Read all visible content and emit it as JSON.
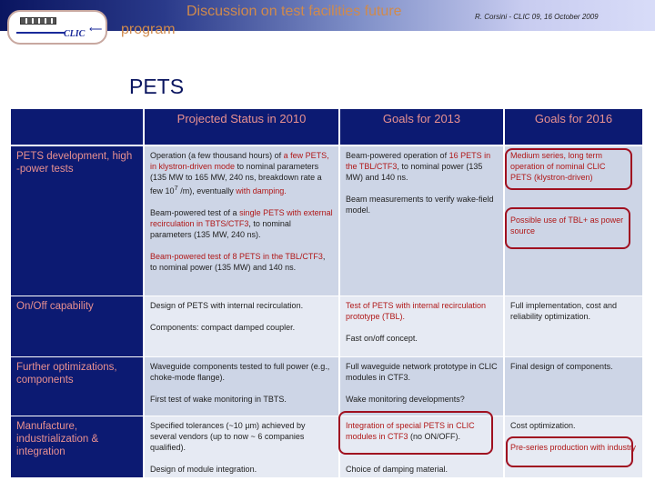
{
  "header": {
    "logo_text": "CLIC",
    "title_line1": "Discussion on test facilities future",
    "title_line2": "program",
    "author": "R. Corsini - CLIC 09, 16 October 2009"
  },
  "slide_title": "PETS",
  "table": {
    "columns": [
      "",
      "Projected Status in 2010",
      "Goals for 2013",
      "Goals for 2016"
    ],
    "rows": [
      {
        "label": "PETS development, high -power tests",
        "c2010": [
          {
            "a": "Operation (a few thousand hours) of ",
            "b": "a few PETS, in klystron-driven mode",
            "c": " to nominal parameters (135 MW to 165 MW, 240 ns, breakdown rate a few 10",
            "sup": "7",
            "d": " /m), eventually ",
            "e": "with damping."
          },
          {
            "a": "Beam-powered test of a ",
            "b": "single PETS with external recirculation in TBTS/CTF3",
            "c": ", to nominal parameters (135 MW, 240 ns)."
          },
          {
            "b": "Beam-powered test of 8 PETS in the TBL/CTF3",
            "c": ", to nominal power (135 MW) and 140 ns."
          }
        ],
        "c2013": [
          {
            "a": "Beam-powered operation of ",
            "b": "16 PETS in the TBL/CTF3",
            "c": ", to nominal power (135 MW) and 140 ns."
          },
          {
            "a": "Beam measurements to verify wake-field model."
          }
        ],
        "c2016": [
          "Medium series, long term operation of nominal CLIC PETS (klystron-driven)",
          "Possible use of TBL+ as power source"
        ]
      },
      {
        "label": "On/Off capability",
        "c2010": [
          "Design of PETS with internal recirculation.",
          "Components: compact damped coupler."
        ],
        "c2013": [
          "Test of PETS with internal recirculation prototype (TBL).",
          "Fast on/off concept."
        ],
        "c2016": [
          "Full implementation, cost and reliability optimization."
        ]
      },
      {
        "label": "Further optimizations, components",
        "c2010": [
          "Waveguide components tested to full power (e.g., choke-mode flange).",
          "First test of wake monitoring in TBTS."
        ],
        "c2013": [
          "Full waveguide network prototype in CLIC modules in CTF3.",
          "Wake monitoring developments?"
        ],
        "c2016": [
          "Final design of components."
        ]
      },
      {
        "label": "Manufacture, industrialization & integration",
        "c2010": [
          "Specified tolerances (~10 µm) achieved by several vendors (up to now ~ 6 companies qualified).",
          "Design of module integration."
        ],
        "c2013": [
          {
            "b": "Integration of special PETS in CLIC modules in CTF3",
            "c": " (no ON/OFF)."
          },
          "Choice of damping material."
        ],
        "c2016": [
          "Cost optimization.",
          "Pre-series production with industry"
        ]
      }
    ]
  },
  "colors": {
    "navy": "#0c1a72",
    "highlight_red": "#b01818",
    "title_orange": "#d08a4c"
  }
}
